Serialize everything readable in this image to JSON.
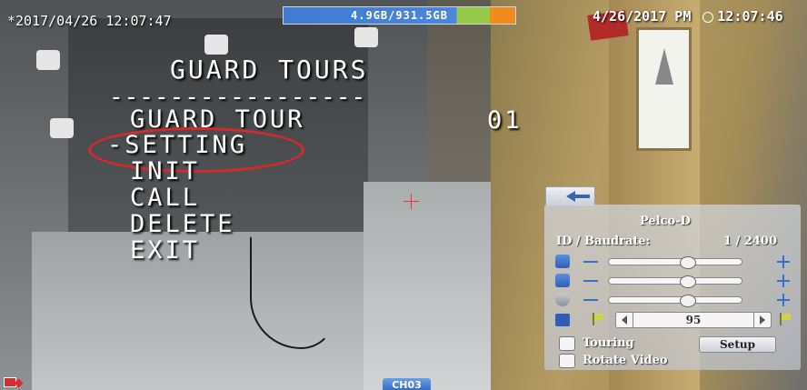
{
  "osd": {
    "datetime_left": "*2017/04/26 12:07:47",
    "hdd_usage": "4.9GB/931.5GB",
    "datetime_right_date": "4/26/2017 PM",
    "datetime_right_time": "12:07:46",
    "channel": "CH03"
  },
  "guard_tours_menu": {
    "title": "GUARD TOURS",
    "separator": "-----------------",
    "guard_tour_label": "GUARD TOUR",
    "guard_tour_number": "01",
    "items": [
      {
        "label": "-SETTING"
      },
      {
        "label": "INIT"
      },
      {
        "label": "CALL"
      },
      {
        "label": "DELETE"
      },
      {
        "label": "EXIT"
      }
    ]
  },
  "ptz_panel": {
    "protocol": "Pelco-D",
    "id_baudrate_label": "ID / Baudrate:",
    "id_baudrate_value": "1 / 2400",
    "sliders": [
      {
        "icon": "zoom-icon",
        "level": 0.6
      },
      {
        "icon": "focus-icon",
        "level": 0.6
      },
      {
        "icon": "iris-icon",
        "level": 0.6
      }
    ],
    "tour_value": "95",
    "touring_label": "Touring",
    "setup_label": "Setup",
    "rotate_video_label": "Rotate Video"
  },
  "colors": {
    "highlight": "#d42a2a",
    "accent": "#3a6ec8",
    "hdd_used": "#4a86db"
  }
}
